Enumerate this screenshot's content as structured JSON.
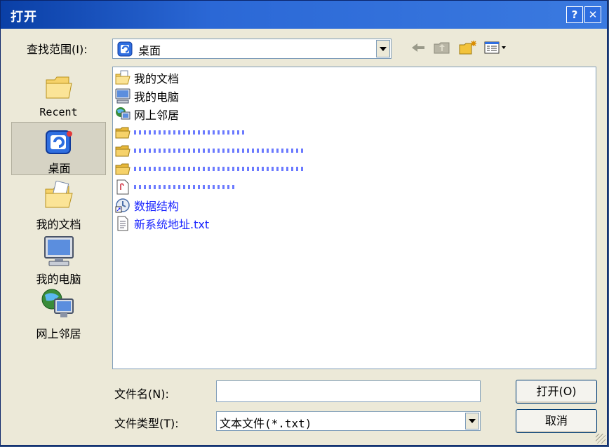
{
  "window": {
    "title": "打开",
    "help_button": "?",
    "close_button": "✕"
  },
  "look_in": {
    "label": "查找范围(I):",
    "value": "桌面"
  },
  "places": [
    {
      "label": "Recent",
      "icon": "recent-folder-icon"
    },
    {
      "label": "桌面",
      "icon": "desktop-icon"
    },
    {
      "label": "我的文档",
      "icon": "my-documents-icon"
    },
    {
      "label": "我的电脑",
      "icon": "my-computer-icon"
    },
    {
      "label": "网上邻居",
      "icon": "network-places-icon"
    }
  ],
  "files": [
    {
      "name": "我的文档",
      "icon": "my-documents-icon"
    },
    {
      "name": "我的电脑",
      "icon": "my-computer-icon"
    },
    {
      "name": "网上邻居",
      "icon": "network-places-icon"
    },
    {
      "name": "",
      "icon": "folder-icon"
    },
    {
      "name": "",
      "icon": "folder-icon"
    },
    {
      "name": "",
      "icon": "folder-icon"
    },
    {
      "name": "",
      "icon": "shortcut-file-icon"
    },
    {
      "name": "数据结构",
      "icon": "shortcut-icon"
    },
    {
      "name": "新系统地址.txt",
      "icon": "text-file-icon"
    }
  ],
  "filename": {
    "label": "文件名(N):",
    "value": ""
  },
  "filetype": {
    "label": "文件类型(T):",
    "value": "文本文件(*.txt)"
  },
  "buttons": {
    "open": "打开(O)",
    "cancel": "取消"
  },
  "colors": {
    "titlebar": "#0a3fa6",
    "dialog_bg": "#ece9d8",
    "link_blue": "#1a24ff"
  }
}
